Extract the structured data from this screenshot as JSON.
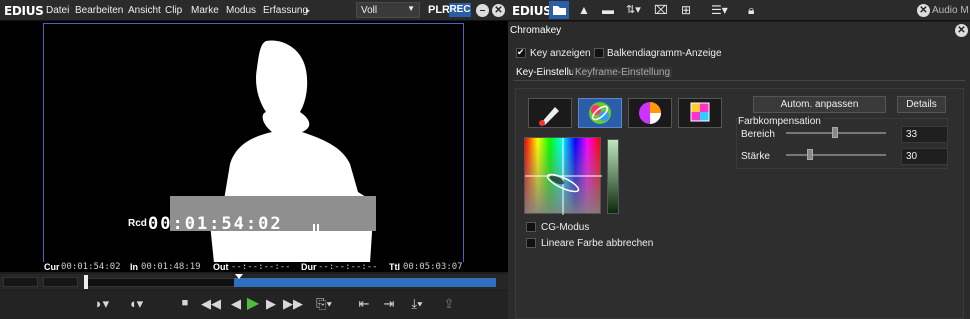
{
  "left_menu": {
    "logo": "EDIUS",
    "items": [
      "Datei",
      "Bearbeiten",
      "Ansicht",
      "Clip",
      "Marke",
      "Modus",
      "Erfassung"
    ],
    "more": "▸",
    "view_select": "Voll",
    "plr": "PLR",
    "rec": "REC"
  },
  "preview": {
    "rcd_label": "Rcd",
    "timecode": "00:01:54:02",
    "tc": {
      "cur_label": "Cur",
      "cur": "00:01:54:02",
      "in_label": "In",
      "in": "00:01:48:19",
      "out_label": "Out",
      "out": "--:--:--:--",
      "dur_label": "Dur",
      "dur": "--:--:--:--",
      "ttl_label": "Ttl",
      "ttl": "00:05:03:07"
    }
  },
  "right_toolbar": {
    "logo": "EDIUS",
    "audio_label": "Audio M"
  },
  "chromakey": {
    "title": "Chromakey",
    "key_anzeigen": "Key anzeigen",
    "key_anzeigen_checked": true,
    "balken": "Balkendiagramm-Anzeige",
    "balken_checked": false,
    "tabs": [
      "Key-Einstellung",
      "Keyframe-Einstellung"
    ],
    "autom_button": "Autom. anpassen",
    "details_button": "Details",
    "farbkompensation": "Farbkompensation",
    "bereich_label": "Bereich",
    "bereich_value": "33",
    "staerke_label": "Stärke",
    "staerke_value": "30",
    "cg_modus": "CG-Modus",
    "lineare": "Lineare Farbe abbrechen"
  },
  "colors": {
    "accent": "#2a5ea8",
    "selection": "#2e6fbf"
  }
}
